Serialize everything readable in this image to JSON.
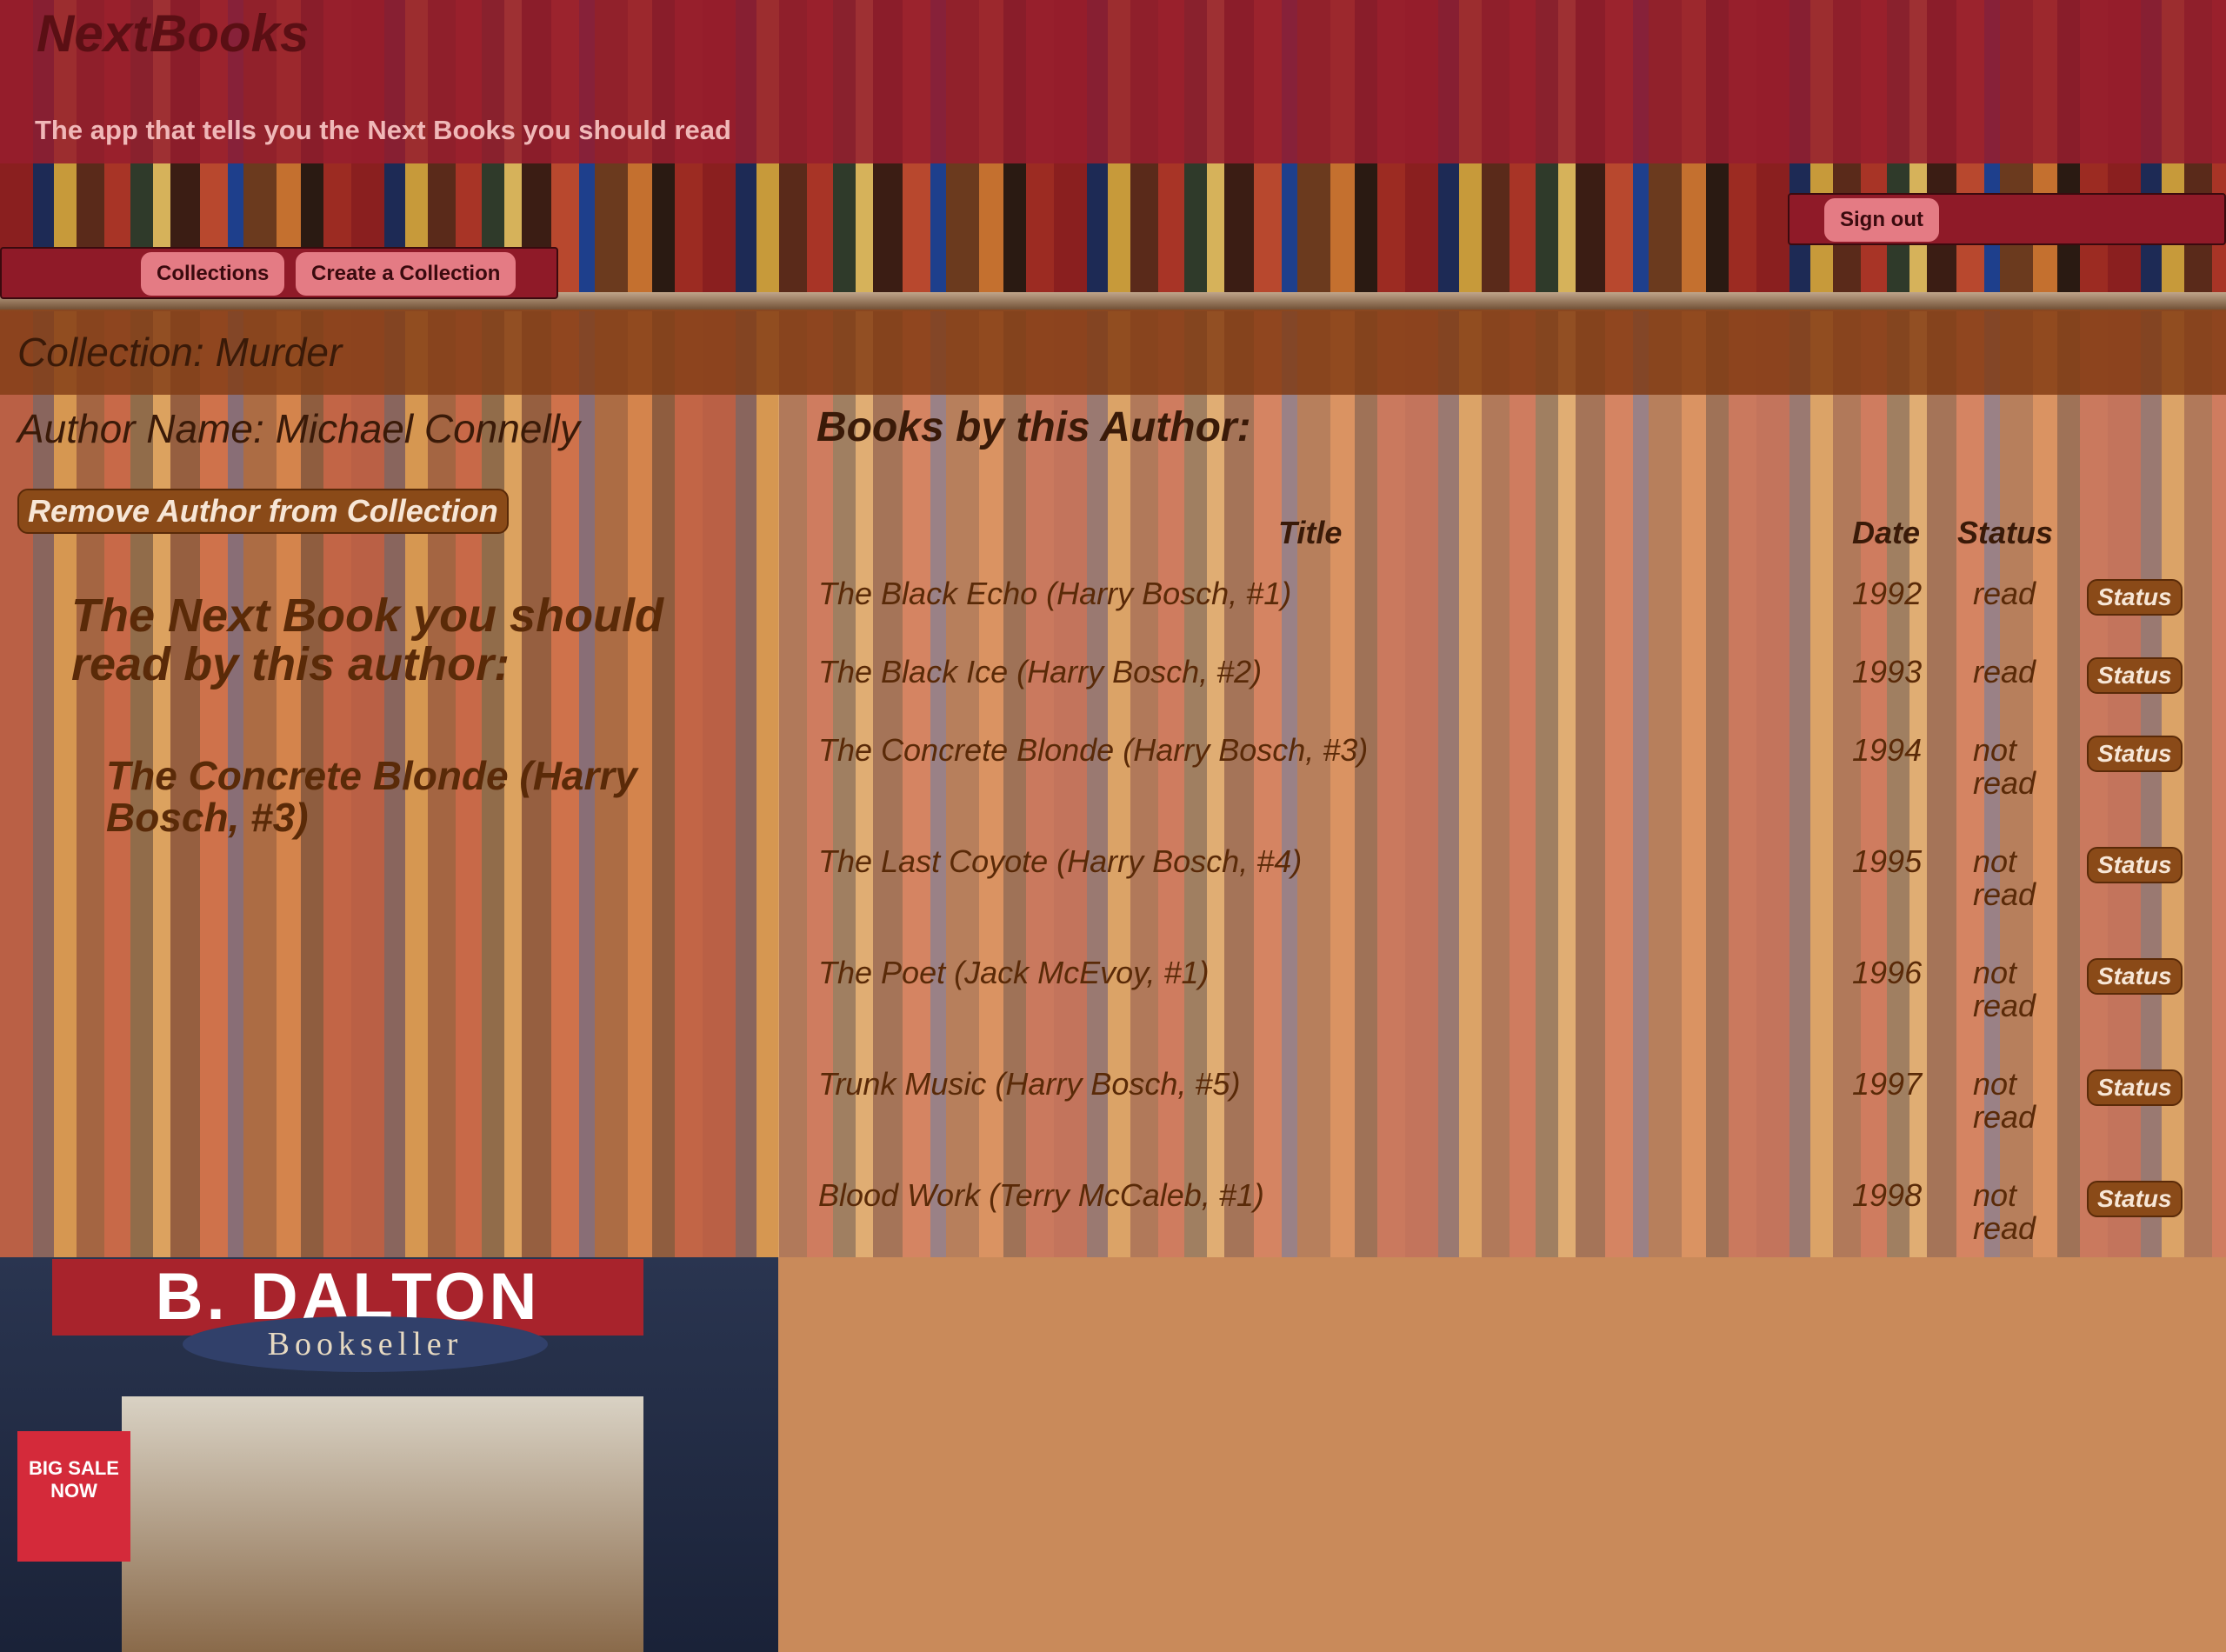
{
  "header": {
    "brand": "NextBooks",
    "tagline": "The app that tells you the Next Books you should read"
  },
  "nav": {
    "collections_label": "Collections",
    "create_label": "Create a Collection",
    "signout_label": "Sign out"
  },
  "collection": {
    "title": "Collection: Murder"
  },
  "author": {
    "name": "Author Name: Michael Connelly",
    "remove_label": "Remove Author from Collection",
    "next_heading": "The Next Book you should read by this author:",
    "next_book": "The Concrete Blonde (Harry Bosch, #3)"
  },
  "store_photo": {
    "sign": "B. DALTON",
    "sub": "Bookseller",
    "sale": "BIG SALE NOW"
  },
  "books": {
    "heading": "Books by this Author:",
    "columns": {
      "title": "Title",
      "date": "Date",
      "status": "Status"
    },
    "status_button_label": "Status",
    "rows": [
      {
        "title": "The Black Echo (Harry Bosch, #1)",
        "date": "1992",
        "status": "read"
      },
      {
        "title": "The Black Ice (Harry Bosch, #2)",
        "date": "1993",
        "status": "read"
      },
      {
        "title": "The Concrete Blonde (Harry Bosch, #3)",
        "date": "1994",
        "status": "not read"
      },
      {
        "title": "The Last Coyote (Harry Bosch, #4)",
        "date": "1995",
        "status": "not read"
      },
      {
        "title": "The Poet (Jack McEvoy, #1)",
        "date": "1996",
        "status": "not read"
      },
      {
        "title": "Trunk Music (Harry Bosch, #5)",
        "date": "1997",
        "status": "not read"
      },
      {
        "title": "Blood Work (Terry McCaleb, #1)",
        "date": "1998",
        "status": "not read"
      }
    ]
  }
}
